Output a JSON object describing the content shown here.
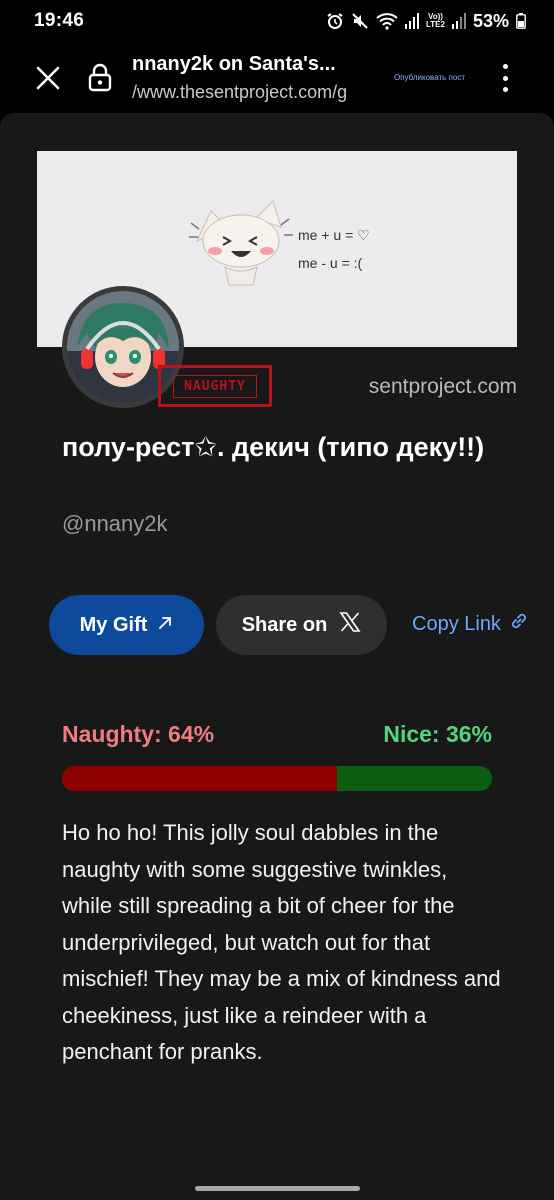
{
  "status_bar": {
    "time": "19:46",
    "volte": "Vo))",
    "lte": "LTE2",
    "battery": "53%",
    "icons": [
      "alarm-icon",
      "mute-icon",
      "wifi-icon",
      "signal-icon",
      "signal-icon",
      "battery-icon"
    ]
  },
  "browser": {
    "title": "nnany2k on Santa's...",
    "url": "/www.thesentproject.com/g",
    "publish_link": "Опубликовать пост",
    "icons": [
      "close-icon",
      "lock-icon",
      "more-vert-icon"
    ]
  },
  "profile": {
    "banner_text_1": "me + u = ♡",
    "banner_text_2": "me - u = :(",
    "stamp_label": "NAUGHTY",
    "site": "sentproject.com",
    "display_name": "полу-рест✩. декич (типо деку!!)",
    "handle": "@nnany2k"
  },
  "actions": {
    "gift_label": "My Gift",
    "share_label": "Share on",
    "copy_label": "Copy Link",
    "icons": [
      "arrow-up-right-icon",
      "x-logo-icon",
      "link-icon"
    ]
  },
  "score": {
    "naughty_label": "Naughty: 64%",
    "nice_label": "Nice: 36%",
    "naughty_percent": 64,
    "colors": {
      "naughty": "#8f0000",
      "nice": "#0b5e14"
    }
  },
  "description": "Ho ho ho! This jolly soul dabbles in the naughty with some suggestive twinkles, while still spreading a bit of cheer for the underprivileged, but watch out for that mischief! They may be a mix of kindness and cheekiness, just like a reindeer with a penchant for pranks."
}
